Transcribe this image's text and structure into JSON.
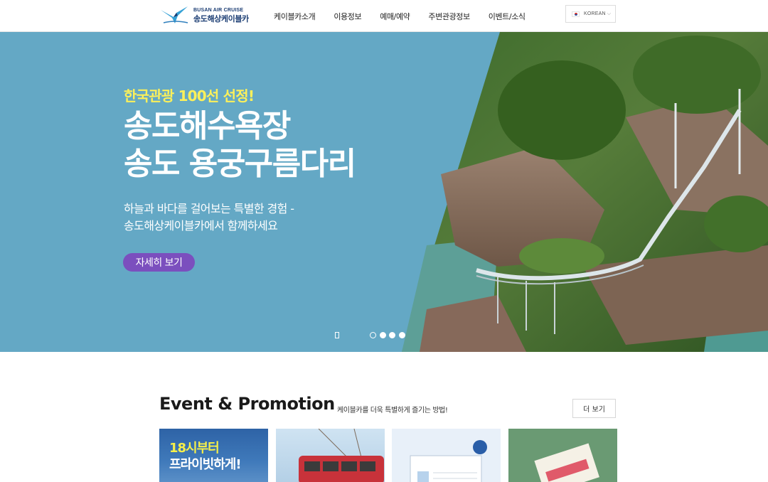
{
  "header": {
    "logo_en": "BUSAN AIR CRUISE",
    "logo_ko": "송도해상케이블카",
    "nav": [
      "케이블카소개",
      "이용정보",
      "예매/예약",
      "주변관광정보",
      "이벤트/소식"
    ],
    "language": "KOREAN"
  },
  "hero": {
    "kicker": "한국관광 100선 선정!",
    "title_line1": "송도해수욕장",
    "title_line2": "송도 용궁구름다리",
    "desc_line1": "하늘과 바다를 걸어보는 특별한 경험 -",
    "desc_line2": "송도해상케이블카에서 함께하세요",
    "cta": "자세히 보기",
    "slides_total": 4,
    "active_slide": 2
  },
  "events": {
    "title": "Event & Promotion",
    "subtitle": "케이블카를 더욱 특별하게 즐기는 방법!",
    "more": "더 보기",
    "card1_line1": "18시부터",
    "card1_line2": "프라이빗하게!"
  },
  "colors": {
    "hero_bg": "#64a8c5",
    "kicker": "#fbf05a",
    "cta": "#7b4fbe",
    "brand": "#1b3d73"
  },
  "icons": {
    "logo": "seagull-logo-icon",
    "flag": "korea-flag-icon",
    "dropdown": "chevron-down-icon",
    "pause": "pause-icon"
  }
}
